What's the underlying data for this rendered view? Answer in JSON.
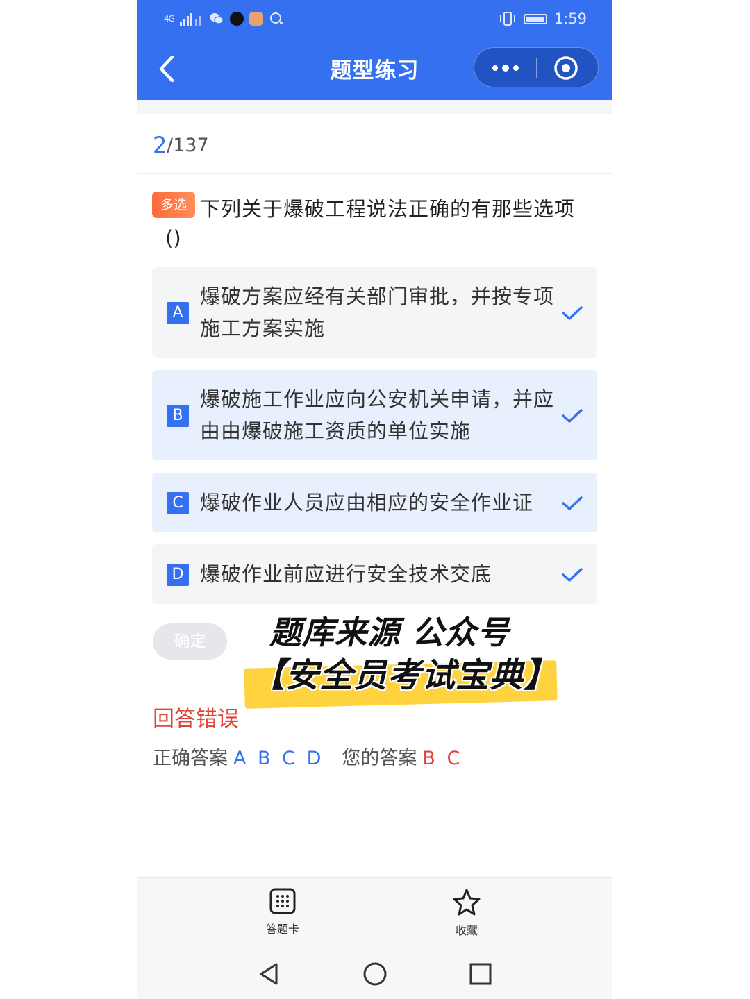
{
  "status_bar": {
    "time": "1:59",
    "signal_text": "4G"
  },
  "header": {
    "title": "题型练习"
  },
  "counter": {
    "current": "2",
    "total": "/137"
  },
  "question": {
    "type_tag": "多选",
    "text": "下列关于爆破工程说法正确的有那些选项",
    "paren": "()"
  },
  "options": [
    {
      "letter": "A",
      "text": "爆破方案应经有关部门审批，并按专项施工方案实施",
      "selected": false
    },
    {
      "letter": "B",
      "text": "爆破施工作业应向公安机关申请，并应由由爆破施工资质的单位实施",
      "selected": true
    },
    {
      "letter": "C",
      "text": "爆破作业人员应由相应的安全作业证",
      "selected": true
    },
    {
      "letter": "D",
      "text": "爆破作业前应进行安全技术交底",
      "selected": false
    }
  ],
  "confirm_label": "确定",
  "watermark": {
    "line1": "题库来源 公众号",
    "line2": "【安全员考试宝典】"
  },
  "result": {
    "status": "回答错误",
    "correct_label": "正确答案",
    "correct_value": "A B C D",
    "your_label": "您的答案",
    "your_value": "B C"
  },
  "bottom_tabs": {
    "answer_card": "答题卡",
    "favorite": "收藏"
  },
  "colors": {
    "primary": "#3470f0",
    "error": "#e0453a",
    "tag": "#ff6a3d"
  }
}
